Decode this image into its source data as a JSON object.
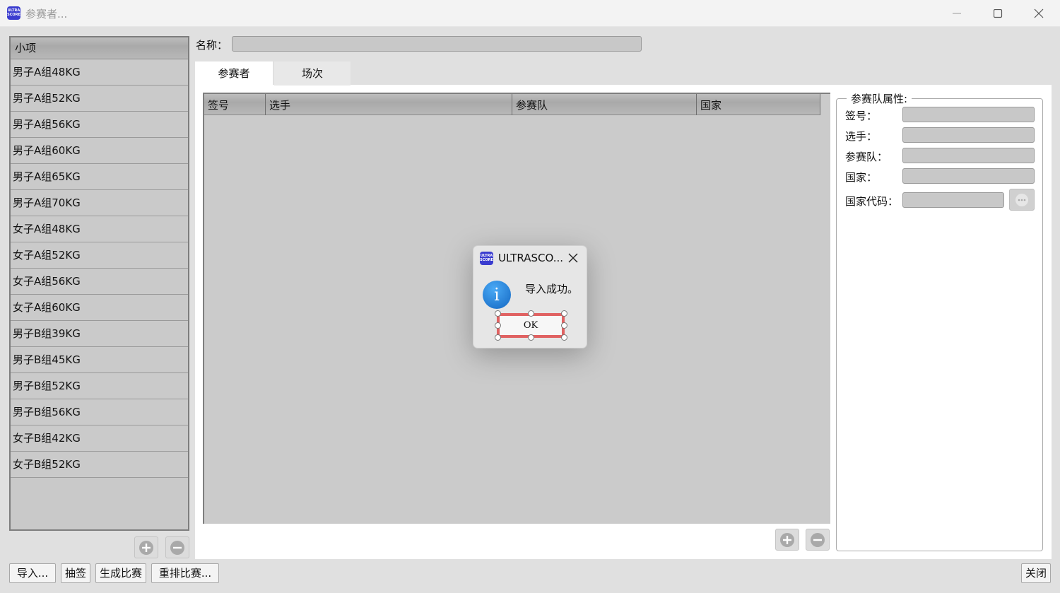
{
  "window": {
    "title": "参赛者...",
    "logo_text": "ULTRA SCORE"
  },
  "events": {
    "header": "小项",
    "items": [
      "男子A组48KG",
      "男子A组52KG",
      "男子A组56KG",
      "男子A组60KG",
      "男子A组65KG",
      "男子A组70KG",
      "女子A组48KG",
      "女子A组52KG",
      "女子A组56KG",
      "女子A组60KG",
      "男子B组39KG",
      "男子B组45KG",
      "男子B组52KG",
      "男子B组56KG",
      "女子B组42KG",
      "女子B组52KG"
    ]
  },
  "name_field": {
    "label": "名称：",
    "value": ""
  },
  "tabs": [
    {
      "label": "参赛者",
      "active": true
    },
    {
      "label": "场次",
      "active": false
    }
  ],
  "participants_grid": {
    "columns": [
      "签号",
      "选手",
      "参赛队",
      "国家"
    ],
    "rows": []
  },
  "team_properties": {
    "title": "参赛队属性:",
    "fields": [
      {
        "label": "签号：",
        "value": ""
      },
      {
        "label": "选手：",
        "value": ""
      },
      {
        "label": "参赛队：",
        "value": ""
      },
      {
        "label": "国家：",
        "value": ""
      },
      {
        "label": "国家代码：",
        "value": ""
      }
    ]
  },
  "bottom_buttons": {
    "import": "导入...",
    "draw": "抽签",
    "generate": "生成比赛",
    "rearrange": "重排比赛...",
    "close": "关闭"
  },
  "dialog": {
    "title": "ULTRASCO...",
    "message": "导入成功。",
    "ok": "OK",
    "icon": "info-icon"
  },
  "colors": {
    "accent_logo": "#3a3ccf",
    "info_blue": "#1a7fd8",
    "selection_red": "#e06262"
  }
}
